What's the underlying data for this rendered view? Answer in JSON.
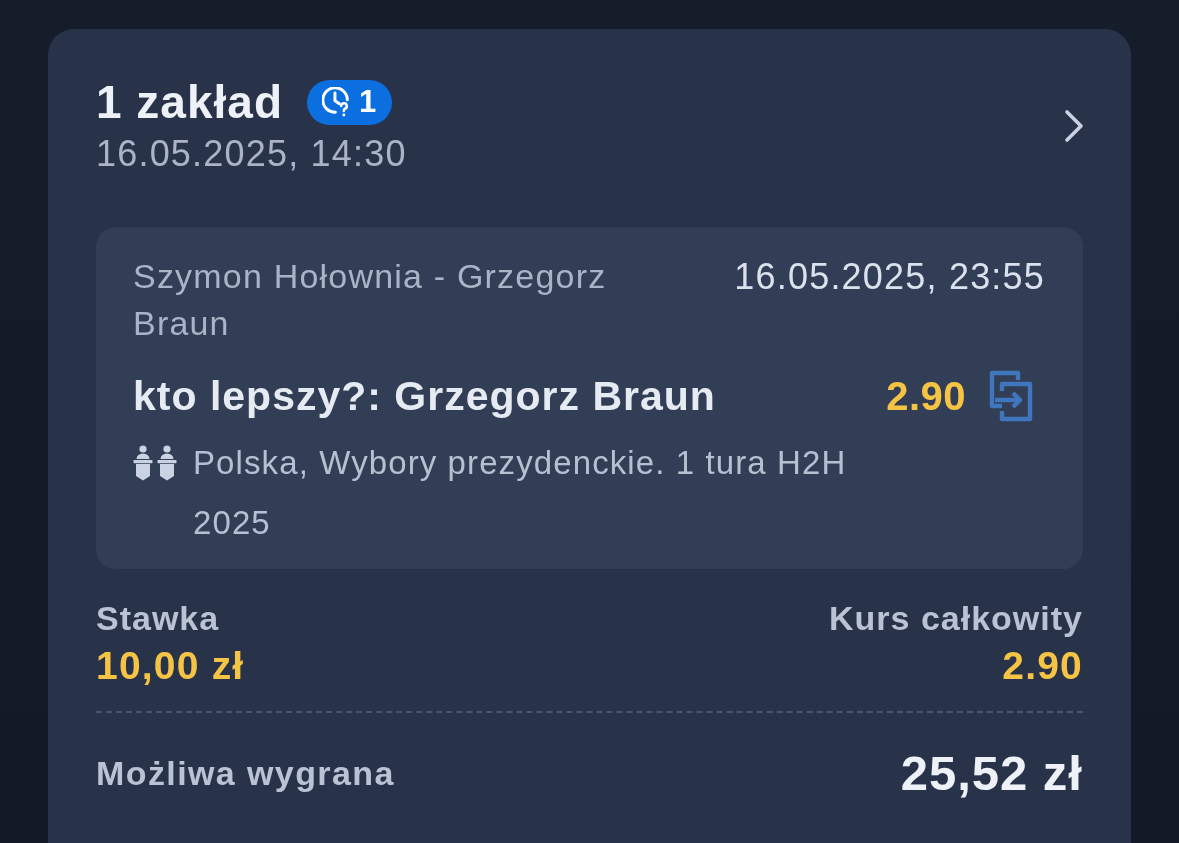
{
  "bet_slip": {
    "title": "1 zakład",
    "badge": {
      "count": "1"
    },
    "date": "16.05.2025, 14:30",
    "selections": [
      {
        "event": "Szymon Hołownia - Grzegorz Braun",
        "event_time": "16.05.2025, 23:55",
        "pick": "kto lepszy?: Grzegorz Braun",
        "odds": "2.90",
        "category": "Polska, Wybory prezydenckie. 1 tura H2H 2025"
      }
    ],
    "stake": {
      "label": "Stawka",
      "value": "10,00 zł"
    },
    "total_odds": {
      "label": "Kurs całkowity",
      "value": "2.90"
    },
    "potential_win": {
      "label": "Możliwa wygrana",
      "value": "25,52 zł"
    }
  }
}
